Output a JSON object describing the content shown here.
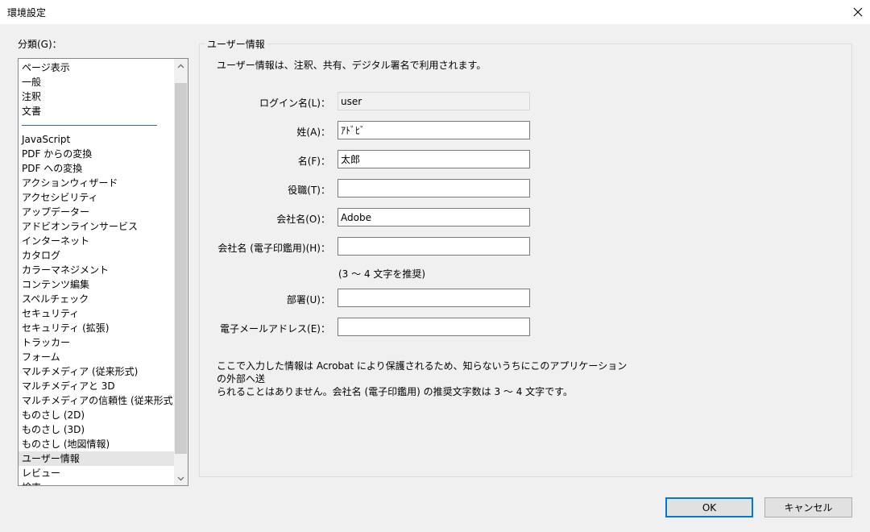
{
  "window": {
    "title": "環境設定"
  },
  "categories": {
    "label": "分類(G)：",
    "top_items": [
      "ページ表示",
      "一般",
      "注釈",
      "文書"
    ],
    "items": [
      "JavaScript",
      "PDF からの変換",
      "PDF への変換",
      "アクションウィザード",
      "アクセシビリティ",
      "アップデーター",
      "アドビオンラインサービス",
      "インターネット",
      "カタログ",
      "カラーマネジメント",
      "コンテンツ編集",
      "スペルチェック",
      "セキュリティ",
      "セキュリティ (拡張)",
      "トラッカー",
      "フォーム",
      "マルチメディア (従来形式)",
      "マルチメディアと 3D",
      "マルチメディアの信頼性 (従来形式)",
      "ものさし (2D)",
      "ものさし (3D)",
      "ものさし (地図情報)",
      "ユーザー情報",
      "レビュー",
      "検索"
    ],
    "selected": "ユーザー情報"
  },
  "user_info": {
    "group_title": "ユーザー情報",
    "intro": "ユーザー情報は、注釈、共有、デジタル署名で利用されます。",
    "fields": {
      "login": {
        "label": "ログイン名(L)：",
        "value": "user"
      },
      "last_name": {
        "label": "姓(A)：",
        "value": "ｱﾄﾞﾋﾞ"
      },
      "first_name": {
        "label": "名(F)：",
        "value": "太郎"
      },
      "title": {
        "label": "役職(T)：",
        "value": ""
      },
      "company": {
        "label": "会社名(O)：",
        "value": "Adobe"
      },
      "company_seal": {
        "label": "会社名 (電子印鑑用)(H)：",
        "value": ""
      },
      "department": {
        "label": "部署(U)：",
        "value": ""
      },
      "email": {
        "label": "電子メールアドレス(E)：",
        "value": ""
      }
    },
    "seal_hint": "(3 ～ 4 文字を推奨)",
    "note_line1": "ここで入力した情報は Acrobat により保護されるため、知らないうちにこのアプリケーションの外部へ送",
    "note_line2": "られることはありません。会社名 (電子印鑑用) の推奨文字数は 3 ～ 4 文字です。"
  },
  "buttons": {
    "ok": "OK",
    "cancel": "キャンセル"
  },
  "icons": {
    "close": "close-icon",
    "scroll_up": "chevron-up-icon",
    "scroll_down": "chevron-down-icon"
  }
}
